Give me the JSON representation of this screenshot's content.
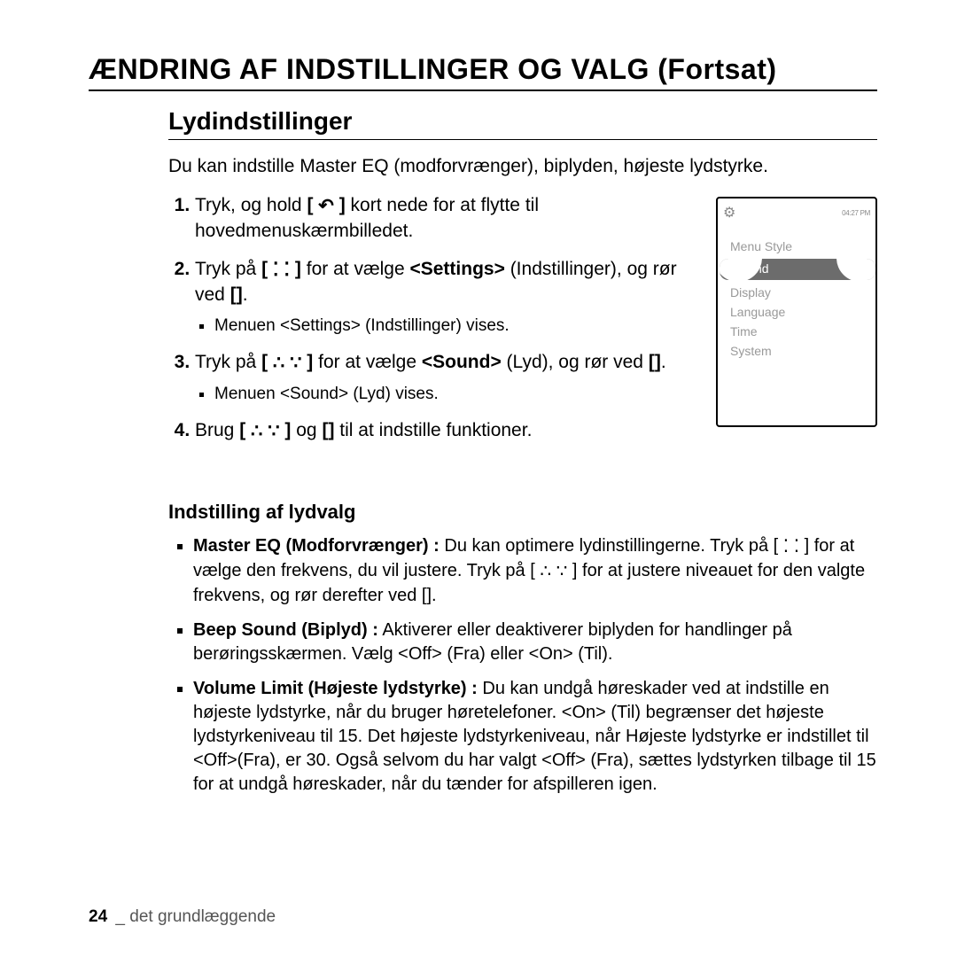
{
  "title": "ÆNDRING AF INDSTILLINGER OG VALG (Fortsat)",
  "section_title": "Lydindstillinger",
  "intro": "Du kan indstille Master EQ (modforvrænger), biplyden, højeste lydstyrke.",
  "steps": {
    "s1a": "Tryk, og hold ",
    "s1b": " kort nede for at flytte til hovedmenuskærmbilledet.",
    "s2a": "Tryk på ",
    "s2b": " for at vælge ",
    "s2c": "<Settings>",
    "s2d": " (Indstillinger), og rør ved ",
    "s2sub": "Menuen <Settings> (Indstillinger) vises.",
    "s3a": "Tryk på ",
    "s3b": " for at vælge ",
    "s3c": "<Sound>",
    "s3d": " (Lyd), og rør ved ",
    "s3sub": "Menuen <Sound> (Lyd) vises.",
    "s4a": "Brug ",
    "s4b": " og ",
    "s4c": " til at indstille funktioner."
  },
  "icons": {
    "back": "↶",
    "lr": "⁚ ⁚",
    "ud": "∴ ∵",
    "enter": "    "
  },
  "device": {
    "time": "04:27 PM",
    "items": [
      "Menu Style",
      "nd",
      "Display",
      "Language",
      "Time",
      "System"
    ],
    "selected_index": 1
  },
  "subsection_title": "Indstilling af lydvalg",
  "options": {
    "o1_label": "Master EQ (Modforvrænger) :",
    "o1_text_a": " Du kan optimere lydinstillingerne. Tryk på ",
    "o1_text_b": " for at vælge den frekvens, du vil justere. Tryk på ",
    "o1_text_c": " for at justere niveauet for den valgte frekvens, og rør derefter ved ",
    "o2_label": "Beep Sound (Biplyd) :",
    "o2_text": " Aktiverer eller deaktiverer biplyden for handlinger på berøringsskærmen. Vælg <Off> (Fra) eller <On> (Til).",
    "o3_label": "Volume Limit (Højeste lydstyrke) :",
    "o3_text": " Du kan undgå høreskader ved at indstille en højeste lydstyrke, når du bruger høretelefoner. <On> (Til) begrænser det højeste lydstyrkeniveau til 15. Det højeste lydstyrkeniveau, når Højeste lydstyrke er indstillet til <Off>(Fra), er 30. Også selvom du har valgt <Off> (Fra), sættes lydstyrken tilbage til 15 for at undgå høreskader, når du tænder for afspilleren igen."
  },
  "footer": {
    "page": "24",
    "sep": "_",
    "section": "det grundlæggende"
  }
}
